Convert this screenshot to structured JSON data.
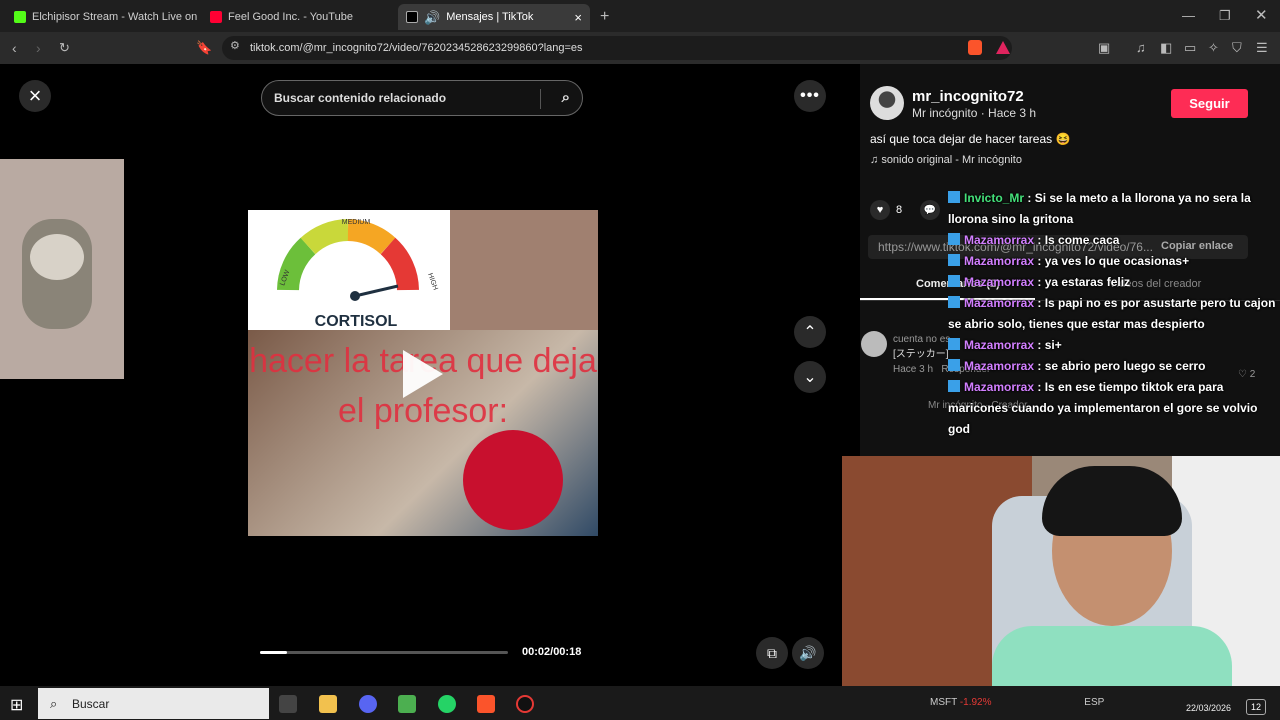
{
  "tabs": [
    {
      "label": "Elchipisor Stream - Watch Live on Kic",
      "color": "#53fc18"
    },
    {
      "label": "Feel Good Inc. - YouTube",
      "color": "#ff0033"
    },
    {
      "label": "Mensajes | TikTok",
      "color": "#ffffff"
    }
  ],
  "address": {
    "url": "tiktok.com/@mr_incognito72/video/7620234528623299860?lang=es"
  },
  "player": {
    "search_placeholder": "Buscar contenido relacionado",
    "gauge_low": "LOW",
    "gauge_medium": "MEDIUM",
    "gauge_high": "HIGH",
    "gauge_label": "CORTISOL",
    "caption": "hacer la tarea que deja el profesor:",
    "timecode": "00:02/00:18",
    "progress": 0.11
  },
  "post": {
    "username": "mr_incognito72",
    "subtitle": "Mr incógnito · Hace 3 h",
    "follow_label": "Seguir",
    "description": "así que toca dejar de hacer tareas 😆",
    "sound": "sonido original - Mr incógnito",
    "likes": "8",
    "link": "https://www.tiktok.com/@mr_incognito72/video/76...",
    "copy_label": "Copiar enlace",
    "tab_comments": "Comentarios (2)",
    "tab_creator": "Vídeos del creador",
    "comment_author": "cuenta no es",
    "comment_text": "[ステッカー]",
    "comment_time": "Hace 3 h",
    "comment_reply": "Responder",
    "comment_likes": "2",
    "reply_author": "Mr incógnito · Creador"
  },
  "chat": [
    {
      "user": "Invicto_Mr",
      "msg": ": Si se la meto a la llorona ya no sera la llorona sino la gritona",
      "green": true
    },
    {
      "user": "Mazamorrax",
      "msg": ": Is come caca"
    },
    {
      "user": "Mazamorrax",
      "msg": ": ya ves lo que ocasionas+"
    },
    {
      "user": "Mazamorrax",
      "msg": ": ya estaras feliz"
    },
    {
      "user": "Mazamorrax",
      "msg": ": Is papi no es por asustarte pero tu cajon se abrio solo, tienes que estar mas despierto"
    },
    {
      "user": "Mazamorrax",
      "msg": ": si+"
    },
    {
      "user": "Mazamorrax",
      "msg": ": se abrio pero luego se cerro"
    },
    {
      "user": "Mazamorrax",
      "msg": ": Is en ese tiempo tiktok era para maricones cuando ya implementaron el gore se volvio god"
    }
  ],
  "taskbar": {
    "search": "Buscar",
    "stock": "MSFT",
    "stock_change": "-1.92%",
    "lang": "ESP",
    "date": "22/03/2026",
    "notifications": "12"
  }
}
